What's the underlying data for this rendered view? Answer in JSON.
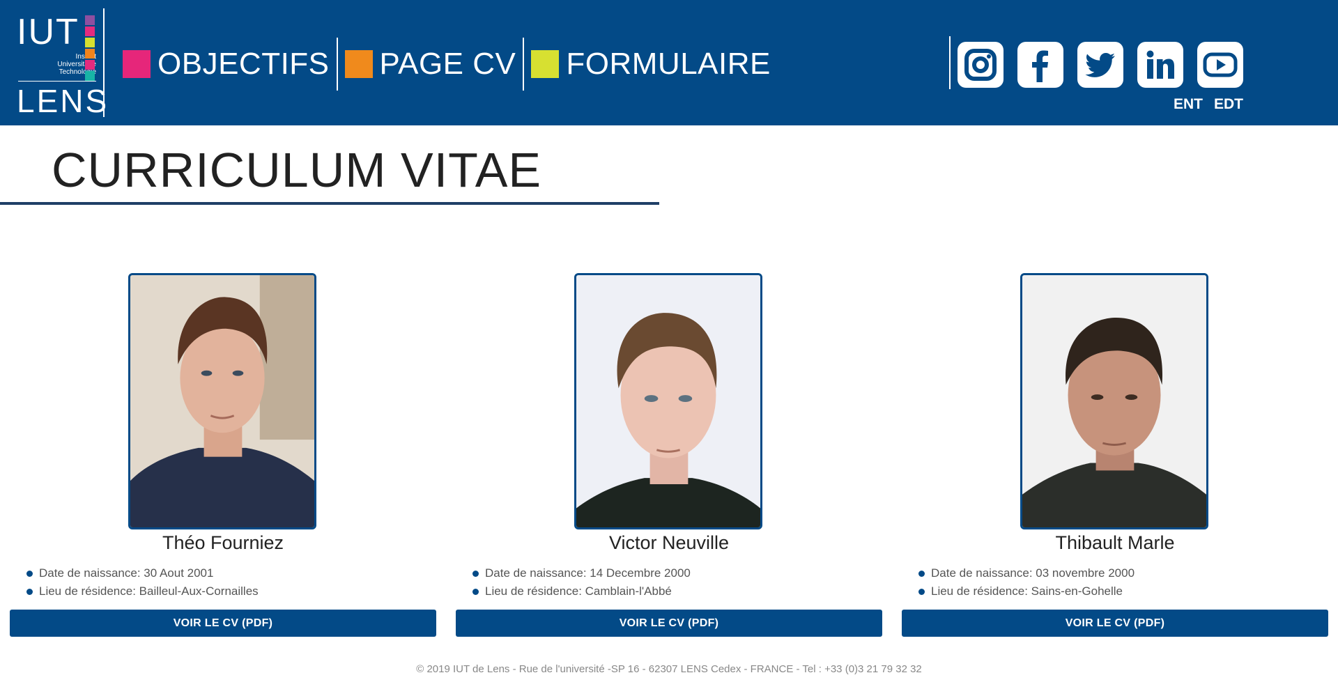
{
  "logo": {
    "top": "IUT",
    "sub_lines": [
      "Institut",
      "Universitaire",
      "Technologie"
    ],
    "bottom": "LENS",
    "square_colors": [
      "#8e4fa0",
      "#e52b7e",
      "#d6e030",
      "#f0841c",
      "#e52b7e",
      "#17b5a6"
    ]
  },
  "nav": [
    {
      "label": "OBJECTIFS",
      "color": "#e6267a"
    },
    {
      "label": "PAGE CV",
      "color": "#f08a1c"
    },
    {
      "label": "FORMULAIRE",
      "color": "#d7e031"
    }
  ],
  "socials": [
    "instagram-icon",
    "facebook-icon",
    "twitter-icon",
    "linkedin-icon",
    "youtube-icon"
  ],
  "quick_links": {
    "ent": "ENT",
    "edt": "EDT"
  },
  "page_title": "CURRICULUM VITAE",
  "cards": [
    {
      "name": "Théo Fourniez",
      "birth_label": "Date de naissance: 30 Aout 2001",
      "residence_label": "Lieu de résidence: Bailleul-Aux-Cornailles",
      "button": "VOIR LE CV (PDF)"
    },
    {
      "name": "Victor Neuville",
      "birth_label": "Date de naissance: 14 Decembre 2000",
      "residence_label": "Lieu de résidence: Camblain-l'Abbé",
      "button": "VOIR LE CV (PDF)"
    },
    {
      "name": "Thibault Marle",
      "birth_label": "Date de naissance: 03 novembre 2000",
      "residence_label": "Lieu de résidence: Sains-en-Gohelle",
      "button": "VOIR LE CV (PDF)"
    }
  ],
  "footer": "© 2019 IUT de Lens - Rue de l'université -SP 16 - 62307 LENS Cedex - FRANCE - Tel : +33 (0)3 21 79 32 32",
  "colors": {
    "brand": "#034a87"
  }
}
